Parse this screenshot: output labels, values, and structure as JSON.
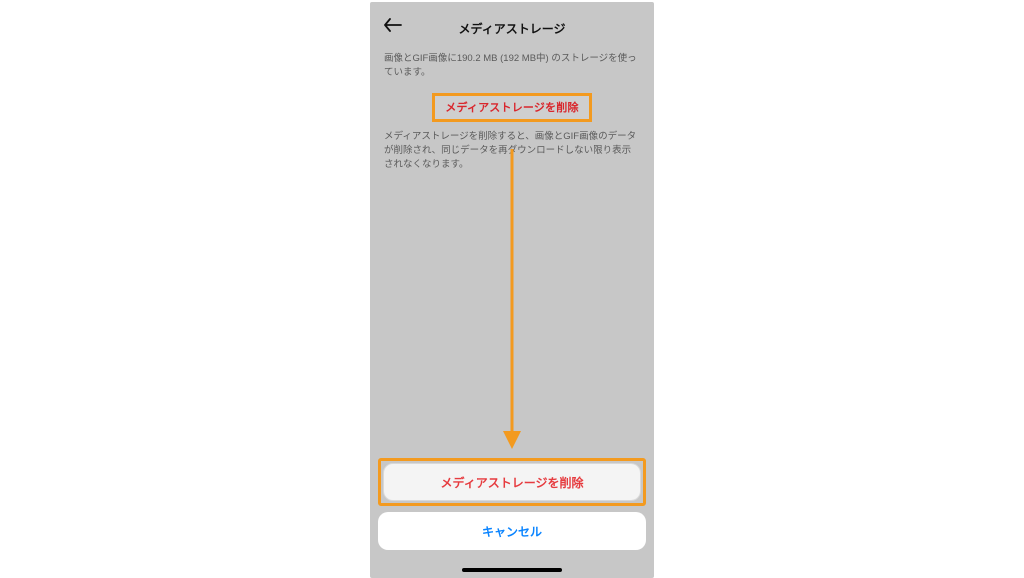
{
  "header": {
    "title": "メディアストレージ"
  },
  "storage": {
    "usage_text": "画像とGIF画像に190.2 MB (192 MB中) のストレージを使っています。",
    "delete_link_label": "メディアストレージを削除",
    "delete_explain": "メディアストレージを削除すると、画像とGIF画像のデータが削除され、同じデータを再ダウンロードしない限り表示されなくなります。"
  },
  "sheet": {
    "confirm_label": "メディアストレージを削除",
    "cancel_label": "キャンセル"
  },
  "annotation": {
    "highlight_color": "#f39a1f",
    "danger_color": "#e63b3f",
    "primary_color": "#0a84ff"
  }
}
